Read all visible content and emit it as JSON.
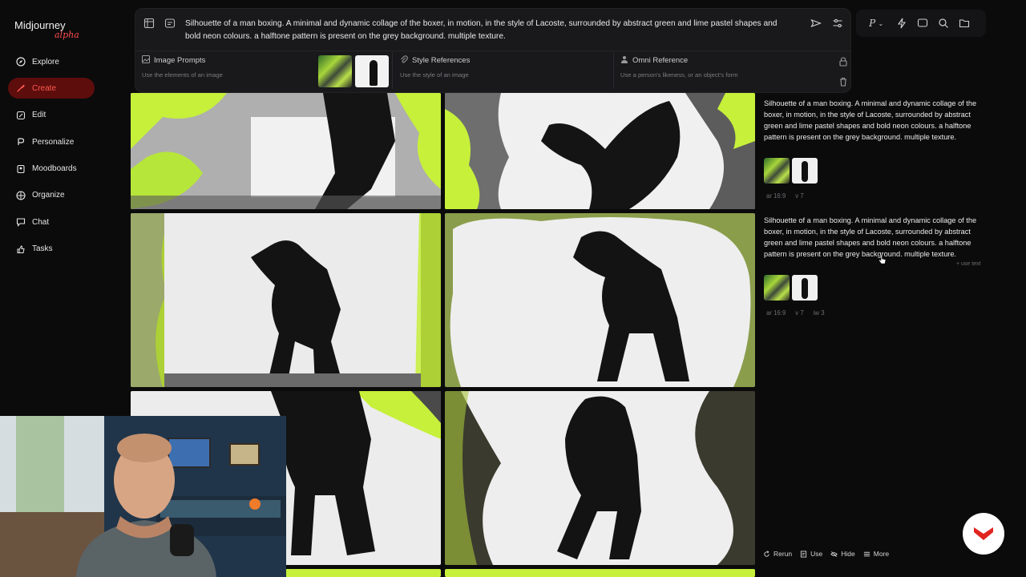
{
  "app": {
    "name": "Midjourney",
    "badge": "alpha"
  },
  "sidebar": {
    "items": [
      {
        "label": "Explore",
        "icon": "compass-icon",
        "active": false
      },
      {
        "label": "Create",
        "icon": "brush-icon",
        "active": true
      },
      {
        "label": "Edit",
        "icon": "edit-icon",
        "active": false
      },
      {
        "label": "Personalize",
        "icon": "personalize-icon",
        "active": false
      },
      {
        "label": "Moodboards",
        "icon": "moodboard-icon",
        "active": false
      },
      {
        "label": "Organize",
        "icon": "grid-icon",
        "active": false
      },
      {
        "label": "Chat",
        "icon": "chat-icon",
        "active": false
      },
      {
        "label": "Tasks",
        "icon": "tasks-icon",
        "active": false
      }
    ],
    "accent": "#ff4d4d"
  },
  "prompt": {
    "text": "Silhouette of a man boxing. A minimal and dynamic collage of the boxer, in motion, in the style of Lacoste, surrounded by abstract green and lime pastel shapes and bold neon colours. a halftone pattern is present on the grey background. multiple texture.",
    "references": {
      "image_prompts": {
        "title": "Image Prompts",
        "subtitle": "Use the elements of an image"
      },
      "style_references": {
        "title": "Style References",
        "subtitle": "Use the style of an image"
      },
      "omni_reference": {
        "title": "Omni Reference",
        "subtitle": "Use a person's likeness, or an object's form"
      }
    }
  },
  "toolbar": {
    "personalize_label": "P"
  },
  "jobs": [
    {
      "description": "Silhouette of a man boxing. A minimal and dynamic collage of the boxer, in motion, in the style of Lacoste, surrounded by abstract green and lime pastel shapes and bold neon colours. a halftone pattern is present on the grey background. multiple texture.",
      "tags": [
        "ar 16:9",
        "v 7"
      ]
    },
    {
      "description": "Silhouette of a man boxing. A minimal and dynamic collage of the boxer, in motion, in the style of Lacoste, surrounded by abstract green and lime pastel shapes and bold neon colours. a halftone pattern is present on the grey background. multiple texture.",
      "tags": [
        "ar 16:9",
        "v 7",
        "iw 3"
      ],
      "use_text": "+ use text"
    }
  ],
  "actions": {
    "rerun": "Rerun",
    "use": "Use",
    "hide": "Hide",
    "more": "More"
  }
}
